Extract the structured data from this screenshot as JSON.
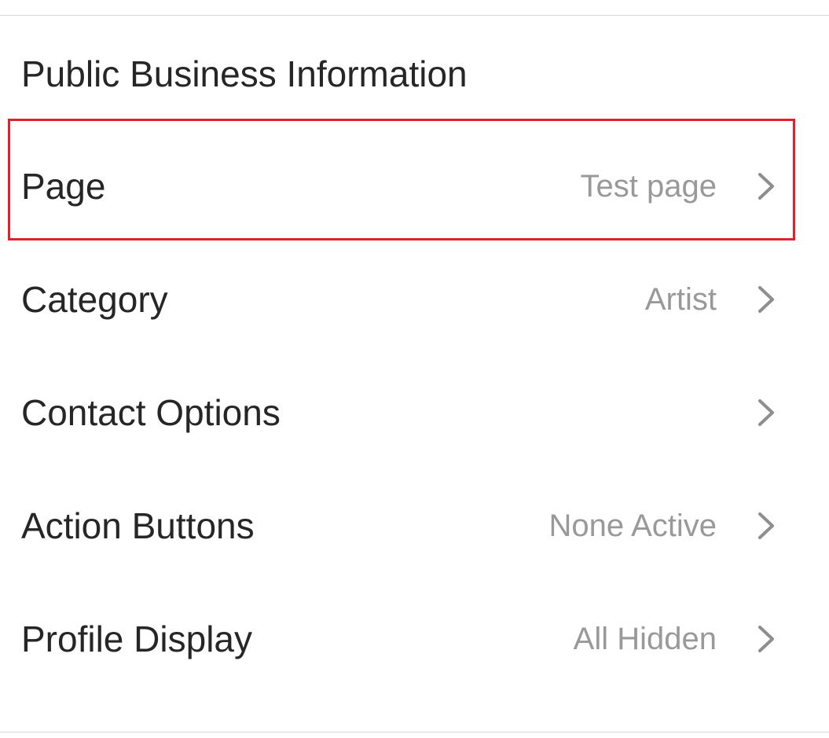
{
  "section": {
    "title": "Public Business Information"
  },
  "rows": [
    {
      "id": "page",
      "label": "Page",
      "value": "Test page",
      "icon": "chevron-right-icon"
    },
    {
      "id": "category",
      "label": "Category",
      "value": "Artist",
      "icon": "chevron-right-icon"
    },
    {
      "id": "contact-options",
      "label": "Contact Options",
      "value": "",
      "icon": "chevron-right-icon"
    },
    {
      "id": "action-buttons",
      "label": "Action Buttons",
      "value": "None Active",
      "icon": "chevron-right-icon"
    },
    {
      "id": "profile-display",
      "label": "Profile Display",
      "value": "All Hidden",
      "icon": "chevron-right-icon"
    }
  ],
  "colors": {
    "label_text": "#262626",
    "value_text": "#999999",
    "chevron": "#8e8e8e",
    "divider": "#dbdbdb",
    "highlight": "#e0202a"
  }
}
